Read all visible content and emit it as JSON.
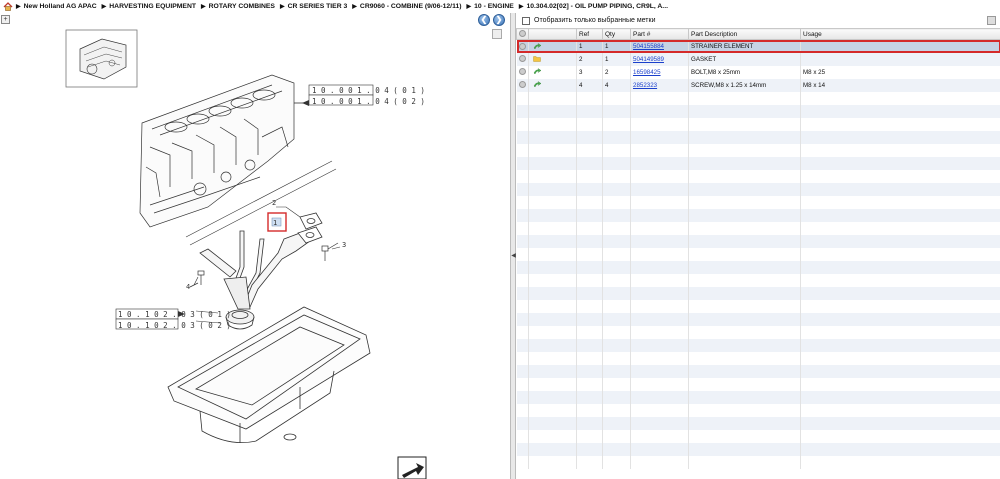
{
  "breadcrumb": {
    "items": [
      "New Holland AG APAC",
      "HARVESTING EQUIPMENT",
      "ROTARY COMBINES",
      "CR SERIES TIER 3",
      "CR9060 - COMBINE (9/06-12/11)",
      "10 - ENGINE",
      "10.304.02[02] - OIL PUMP PIPING, CR9L, A..."
    ]
  },
  "drawing": {
    "refs": {
      "ref1": "1",
      "ref2": "2",
      "ref3": "3",
      "ref4": "4"
    },
    "group_labels": {
      "top_a": "1 0 . 0 0 1 . 0 4 ( 0 1 )",
      "top_b": "1 0 . 0 0 1 . 0 4 ( 0 2 )",
      "mid_a": "1 0 . 1 0 2 . 0 3 ( 0 1 )",
      "mid_b": "1 0 . 1 0 2 . 0 3 ( 0 2 )"
    }
  },
  "filter": {
    "label": "Отобразить только выбранные метки"
  },
  "table": {
    "headers": {
      "ref": "Ref",
      "qty": "Qty",
      "part": "Part #",
      "desc": "Part Description",
      "usage": "Usage"
    },
    "rows": [
      {
        "ref": "1",
        "qty": "1",
        "part": "504155884",
        "desc": "STRAINER ELEMENT",
        "usage": "",
        "icon": "green-arrow-icon"
      },
      {
        "ref": "2",
        "qty": "1",
        "part": "504149589",
        "desc": "GASKET",
        "usage": "",
        "icon": "yellow-folder-icon"
      },
      {
        "ref": "3",
        "qty": "2",
        "part": "16598425",
        "desc": "BOLT,M8 x 25mm",
        "usage": "M8 x 25",
        "icon": "green-arrow-icon"
      },
      {
        "ref": "4",
        "qty": "4",
        "part": "2852323",
        "desc": "SCREW,M8 x 1.25  x 14mm",
        "usage": "M8 x 14",
        "icon": "green-arrow-icon"
      }
    ]
  },
  "colors": {
    "selection_outline": "#d42a2a",
    "selected_row": "#c6d3e4",
    "link": "#1a3fcc"
  }
}
